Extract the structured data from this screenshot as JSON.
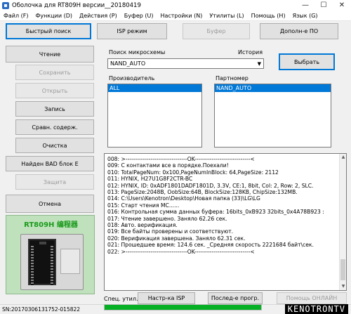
{
  "window": {
    "title": "Оболочка для RT809H версии__20180419",
    "controls": {
      "minimize": "—",
      "maximize": "☐",
      "close": "✕"
    }
  },
  "menu": [
    "Файл (F)",
    "Функции (D)",
    "Действия (P)",
    "Буфер (U)",
    "Настройки (N)",
    "Утилиты (L)",
    "Помощь (H)",
    "Язык (G)"
  ],
  "toolbar": {
    "quick_search": "Быстрый поиск",
    "isp_mode": "ISP режим",
    "buffer": "Буфер",
    "extra": "Дополн-е ПО"
  },
  "left_buttons": {
    "read": "Чтение",
    "save": "Сохранить",
    "open": "Открыть",
    "write": "Запись",
    "compare": "Сравн. содерж.",
    "erase": "Очистка",
    "bad_block": "Найден BAD блок E",
    "protect": "Защита",
    "cancel": "Отмена"
  },
  "chip_search": {
    "label": "Поиск микросхемы",
    "history_label": "История",
    "value": "NAND_AUTO",
    "select_button": "Выбрать"
  },
  "manufacturer": {
    "label": "Производитель",
    "selected": "ALL"
  },
  "partnumber": {
    "label": "Партномер",
    "selected": "NAND_AUTO"
  },
  "log_lines": [
    "008: >--------------------------------OK-----------------------------<",
    "009: С контактами все в порядке.Поехали!",
    "010: TotalPageNum: 0x100,PageNumInBlock: 64,PageSize: 2112",
    "011: HYNIX, H27U1G8F2CTR-BC",
    "012: HYNIX, ID: 0xADF1801DADF1801D, 3.3V, CE:1, 8bit, Col: 2, Row: 2, SLC.",
    "013: PageSize:2048B, OobSize:64B, BlockSize:128KB, ChipSize:132MB.",
    "014: C:\\Users\\Kenotron\\Desktop\\Новая папка (33)\\LG\\LG",
    "015: Старт чтения MC......",
    "016: Контрольная сумма данных буфера: 16bits_0xB923  32bits_0x4A78B923 :",
    "017: Чтение завершено. Заняло 62.26 сек.",
    "018: Авто. верификация.",
    "019: Все байты проверены и соответствуют.",
    "020: Верификация завершена. Заняло 62.31 сек.",
    "021: Прошедшее время: 124.6 сек. _Средняя скорость 2221684 байт\\сек.",
    "022: >--------------------------------OK-----------------------------<"
  ],
  "bottom": {
    "spec_util": "Спец. утил.",
    "isp_settings": "Настр-ка ISP",
    "last_prog": "Послед-е прогр.",
    "online_help": "Помощь ОНЛАЙН"
  },
  "status": {
    "sn": "SN:20170306131752-015822"
  },
  "progress": {
    "fraction": 1.0
  },
  "programmer_image": {
    "caption": "RT809H 编程器"
  },
  "watermark": "KENOTRONTV",
  "colors": {
    "accent": "#0078d7",
    "progress": "#06b025",
    "image_bg": "#bfe2bd"
  }
}
